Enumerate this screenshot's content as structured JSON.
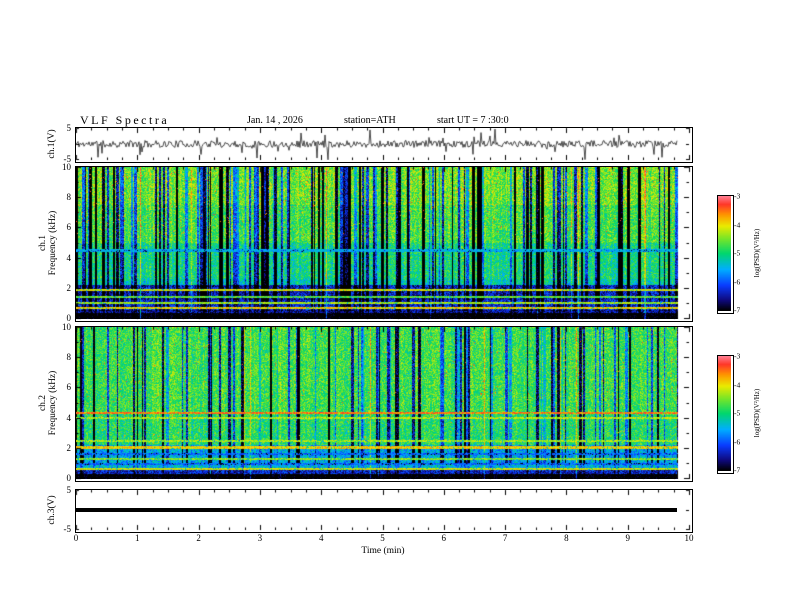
{
  "header": {
    "title": "VLF  Spectra",
    "date": "Jan. 14 , 2026",
    "station": "station=ATH",
    "start_ut": "start UT =  7 :30:0"
  },
  "axes": {
    "time": {
      "label": "Time  (min)",
      "range_min": [
        0,
        10
      ],
      "ticks": [
        0,
        1,
        2,
        3,
        4,
        5,
        6,
        7,
        8,
        9,
        10
      ]
    },
    "wave1": {
      "label": "ch.1(V)",
      "range_v": [
        -5,
        5
      ],
      "ticks": [
        5,
        -5
      ]
    },
    "spec1": {
      "label_line1": "ch.1",
      "label_line2": "Frequency  (kHz)",
      "range_khz": [
        0,
        10
      ],
      "ticks": [
        10,
        8,
        6,
        4,
        2,
        0
      ]
    },
    "spec2": {
      "label_line1": "ch.2",
      "label_line2": "Frequency  (kHz)",
      "range_khz": [
        0,
        10
      ],
      "ticks": [
        10,
        8,
        6,
        4,
        2,
        0
      ]
    },
    "wave3": {
      "label": "ch.3(V)",
      "range_v": [
        -5,
        5
      ],
      "ticks": [
        5,
        -5
      ]
    }
  },
  "colorbar": {
    "label": "log(PSD)(V²/Hz)",
    "ticks": [
      -3,
      -4,
      -5,
      -6,
      -7
    ],
    "range": [
      -7,
      -3
    ],
    "colormap": "rainbow: black→dark blue→blue→cyan→green→yellow→orange→red→pink"
  },
  "chart_data": [
    {
      "name": "ch1_waveform",
      "type": "line",
      "panel": 1,
      "x_range_min": [
        0,
        9.8
      ],
      "y_range_v": [
        -5,
        5
      ],
      "line_color": "#000000",
      "description": "continuous broadband noise of about ±1 V with frequent impulsive spikes reaching ±4 V across the whole 0–9.8 min record"
    },
    {
      "name": "ch1_spectrogram",
      "type": "heatmap",
      "panel": 2,
      "x_range_min": [
        0,
        9.8
      ],
      "y_range_khz": [
        0,
        10
      ],
      "z_range_logpsd": [
        -7,
        -3
      ],
      "bands": [
        {
          "below_khz": 0.35,
          "level": -7.2
        },
        {
          "below_khz": 0.55,
          "level": -6.5
        },
        {
          "below_khz": 2.2,
          "level": -6.2
        },
        {
          "below_khz": 2.6,
          "level": -5.0
        },
        {
          "below_khz": 5.0,
          "level": -4.8
        },
        {
          "below_khz": 7.5,
          "level": -4.5
        },
        {
          "below_khz": 10.1,
          "level": -4.3
        }
      ],
      "spectral_lines": [
        {
          "khz": 0.7,
          "level": -3.9
        },
        {
          "khz": 1.05,
          "level": -4.3
        },
        {
          "khz": 1.45,
          "level": -4.6
        },
        {
          "khz": 1.9,
          "level": -4.1
        },
        {
          "khz": 4.5,
          "level": -5.5
        }
      ],
      "description": "green broadband background cut by dense dark-blue vertical dropout stripes; red speckle above 5.5 kHz; dark band 0.55–2.2 kHz carrying bright harmonic lines; black below 0.35 kHz"
    },
    {
      "name": "ch2_spectrogram",
      "type": "heatmap",
      "panel": 3,
      "x_range_min": [
        0,
        9.8
      ],
      "y_range_khz": [
        0,
        10
      ],
      "z_range_logpsd": [
        -7,
        -3
      ],
      "bands": [
        {
          "below_khz": 0.3,
          "level": -7.2
        },
        {
          "below_khz": 0.55,
          "level": -6.3
        },
        {
          "below_khz": 2.2,
          "level": -5.4
        },
        {
          "below_khz": 4.2,
          "level": -4.75
        },
        {
          "below_khz": 10.1,
          "level": -4.6
        }
      ],
      "spectral_lines": [
        {
          "khz": 0.65,
          "level": -4.1
        },
        {
          "khz": 0.95,
          "level": -5.9
        },
        {
          "khz": 1.3,
          "level": -4.4
        },
        {
          "khz": 1.65,
          "level": -5.9
        },
        {
          "khz": 2.05,
          "level": -3.9
        },
        {
          "khz": 2.5,
          "level": -4.3
        },
        {
          "khz": 4.0,
          "level": -4.2
        },
        {
          "khz": 4.35,
          "level": -3.5
        }
      ],
      "description": "smoother green-cyan background with sparser dark vertical dropouts; strong continuous orange line near 4.35 kHz and yellow-green lines near 2.05 and 4.0 kHz; banded structure below 2.2 kHz; black below 0.3 kHz"
    },
    {
      "name": "ch3_waveform",
      "type": "line",
      "panel": 4,
      "x_range_min": [
        0,
        9.8
      ],
      "y_range_v": [
        -5,
        5
      ],
      "line_color": "#000000",
      "description": "constant 0 V — flat thick black line (channel inactive)"
    }
  ]
}
